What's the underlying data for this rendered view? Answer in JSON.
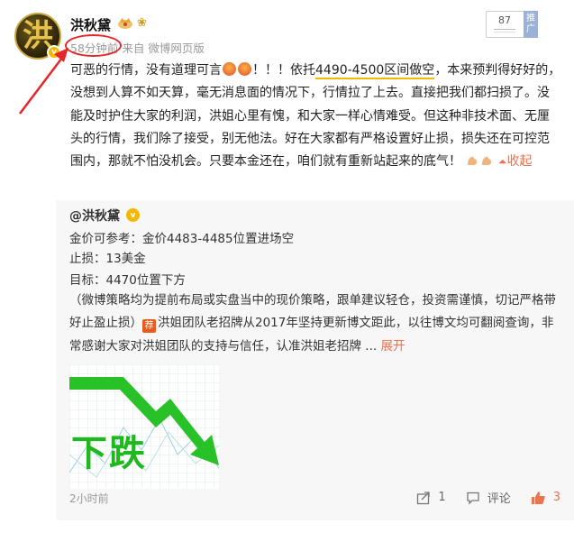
{
  "author": {
    "name": "洪秋黛",
    "verified_badge": "v",
    "avatar_glyph": "洪"
  },
  "meta": {
    "time": "58分钟前",
    "source": "来自 微博网页版"
  },
  "ad": {
    "count": "87",
    "tag": "推广"
  },
  "post": {
    "part1": "可恶的行情，没有道理可言",
    "part2": "！！！依托",
    "highlight": "4490-4500区间做空",
    "part3": "，本来预判得好好的，没想到人算不如天算，毫无消息面的情况下，行情拉了上去。直接把我们都扫损了。没能及时护住大家的利润，洪姐心里有愧，和大家一样心情难受。但这种非技术面、无厘头的行情，我们除了接受，别无他法。好在大家都有严格设置好止损，损失还在可控范围内，那就不怕没机会。只要本金还在，咱们就有重新站起来的底气！",
    "collapse_label": "收起"
  },
  "repost": {
    "author": "@洪秋黛",
    "line1": "金价可参考：金价4483-4485位置进场空",
    "line2": "止损：13美金",
    "line3": "目标：4470位置下方",
    "disclaimer": "（微博策略均为提前布局或实盘当中的现价策略，跟单建议轻仓，投资需谨慎，切记严格带好止盈止损）",
    "recruit_icon": "荐",
    "recruit": "洪姐团队老招牌从2017年坚持更新博文距此，以往博文均可翻阅查询，非常感谢大家对洪姐团队的支持与信任，认准洪姐老招牌 ...",
    "expand_label": "展开",
    "image_label": "下跌",
    "time": "2小时前",
    "repost_count": "1",
    "comment_label": "评论",
    "like_count": "3"
  },
  "colors": {
    "accent": "#eb7350",
    "highlight_underline": "#f5b800",
    "annotation_red": "#e8262a",
    "chart_green": "#1fb81f"
  }
}
